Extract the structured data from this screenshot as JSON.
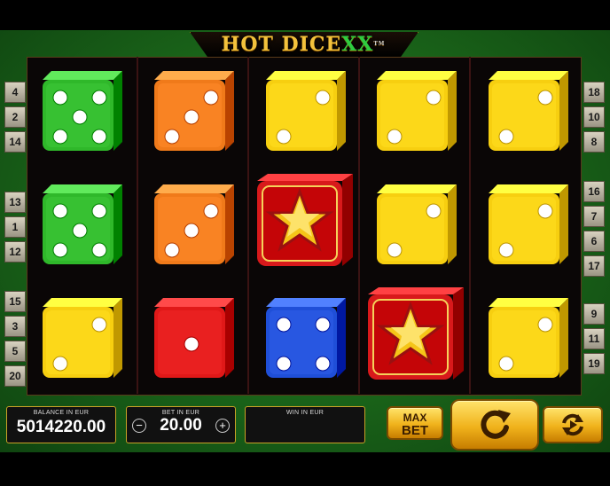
{
  "game": {
    "title_main": "HOT DICE",
    "title_xx": "XX",
    "title_tm": "TM"
  },
  "paylines": {
    "left_top": [
      "4",
      "2",
      "14"
    ],
    "left_mid": [
      "13",
      "1",
      "12"
    ],
    "left_bot": [
      "15",
      "3",
      "5",
      "20"
    ],
    "right_top": [
      "18",
      "10",
      "8"
    ],
    "right_mid": [
      "16",
      "7",
      "6",
      "17"
    ],
    "right_bot": [
      "9",
      "11",
      "19"
    ]
  },
  "grid": [
    [
      {
        "color": "green",
        "pips": 5
      },
      {
        "color": "orange",
        "pips": 3
      },
      {
        "color": "yellow",
        "pips": 2
      },
      {
        "color": "yellow",
        "pips": 2
      },
      {
        "color": "yellow",
        "pips": 2
      }
    ],
    [
      {
        "color": "green",
        "pips": 5
      },
      {
        "color": "orange",
        "pips": 3
      },
      {
        "color": "star"
      },
      {
        "color": "yellow",
        "pips": 2
      },
      {
        "color": "yellow",
        "pips": 2
      }
    ],
    [
      {
        "color": "yellow",
        "pips": 2
      },
      {
        "color": "red",
        "pips": 1
      },
      {
        "color": "blue",
        "pips": 4
      },
      {
        "color": "star"
      },
      {
        "color": "yellow",
        "pips": 2
      }
    ]
  ],
  "colors": {
    "green": "#2fb82a",
    "orange": "#f07a1a",
    "yellow": "#f7cf10",
    "red": "#e01818",
    "blue": "#1f4fd8",
    "star": "#d8191b"
  },
  "balance": {
    "label": "BALANCE IN EUR",
    "value": "5014220.00"
  },
  "bet": {
    "label": "BET IN EUR",
    "value": "20.00",
    "minus": "−",
    "plus": "+"
  },
  "win": {
    "label": "WIN IN EUR",
    "value": ""
  },
  "buttons": {
    "max_bet_line1": "MAX",
    "max_bet_line2": "BET",
    "spin_icon": "spin-arrow-icon",
    "autoplay_icon": "autoplay-icon"
  }
}
